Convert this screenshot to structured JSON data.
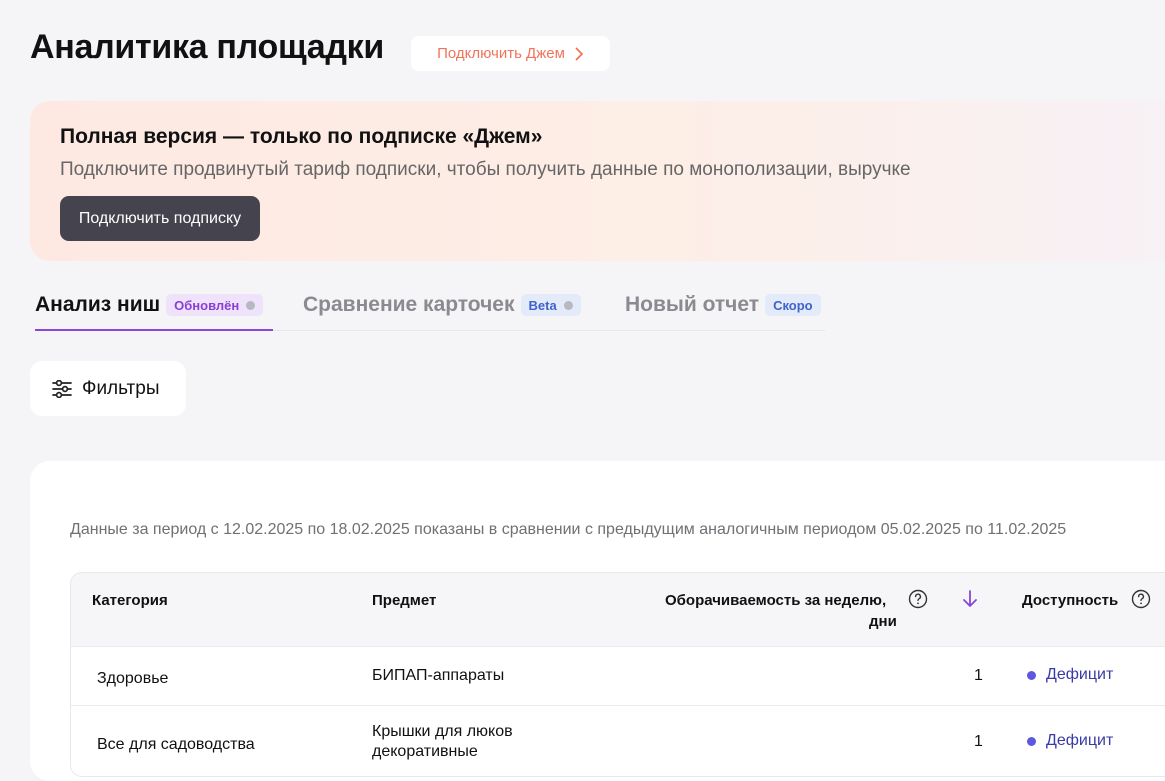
{
  "header": {
    "title": "Аналитика площадки",
    "jem_link": "Подключить Джем"
  },
  "promo": {
    "title": "Полная версия — только по подписке «Джем»",
    "description": "Подключите продвинутый тариф подписки, чтобы получить данные по монополизации, выручке",
    "button": "Подключить подписку"
  },
  "tabs": [
    {
      "label": "Анализ ниш",
      "badge": "Обновлён",
      "badge_color": "purple",
      "active": true
    },
    {
      "label": "Сравнение карточек",
      "badge": "Beta",
      "badge_color": "blue",
      "active": false
    },
    {
      "label": "Новый отчет",
      "badge": "Скоро",
      "badge_color": "blue",
      "active": false
    }
  ],
  "filters": {
    "label": "Фильтры",
    "icon": "sliders-icon"
  },
  "report": {
    "period_note": "Данные за период с 12.02.2025 по 18.02.2025 показаны в сравнении с предыдущим аналогичным периодом 05.02.2025 по 11.02.2025",
    "columns": {
      "category": "Категория",
      "subject": "Предмет",
      "turnover_line1": "Оборачиваемость за неделю,",
      "turnover_line2": "дни",
      "availability": "Доступность"
    },
    "rows": [
      {
        "category": "Здоровье",
        "subject": "БИПАП-аппараты",
        "turnover": "1",
        "availability": "Дефицит"
      },
      {
        "category": "Все для садоводства",
        "subject": "Крышки для люков декоративные",
        "turnover": "1",
        "availability": "Дефицит"
      }
    ]
  },
  "colors": {
    "accent": "#8a45d9",
    "jem": "#f0745a",
    "status_deficit": "#5d58e0",
    "promo_button": "#45434d"
  }
}
